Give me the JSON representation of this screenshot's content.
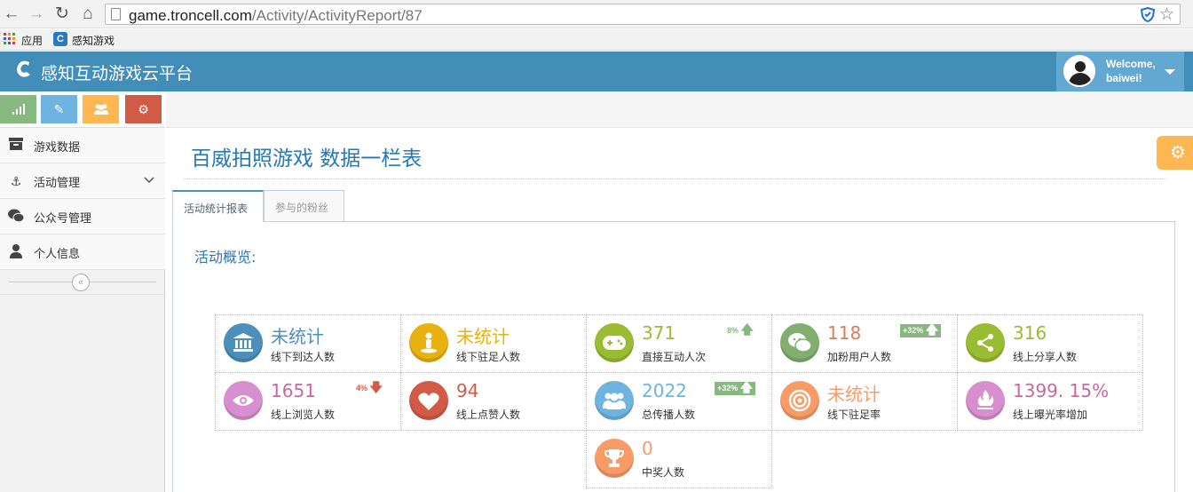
{
  "browser": {
    "url_host": "game.troncell.com",
    "url_path": "/Activity/ActivityReport/87",
    "bookmarks": [
      {
        "label": "应用"
      },
      {
        "label": "感知游戏"
      }
    ]
  },
  "navbar": {
    "brand": "感知互动游戏云平台",
    "welcome_line1": "Welcome,",
    "welcome_line2": "baiwei!"
  },
  "sidebar": {
    "shortcuts": [
      {
        "icon": "signal-icon",
        "color": "#87b87f"
      },
      {
        "icon": "pencil-icon",
        "color": "#6fb3e0"
      },
      {
        "icon": "group-icon",
        "color": "#ffb752"
      },
      {
        "icon": "cogs-icon",
        "color": "#d15b47"
      }
    ],
    "items": [
      {
        "label": "游戏数据",
        "icon": "archive-icon"
      },
      {
        "label": "活动管理",
        "icon": "anchor-icon"
      },
      {
        "label": "公众号管理",
        "icon": "wechat-icon"
      },
      {
        "label": "个人信息",
        "icon": "user-icon"
      }
    ]
  },
  "page": {
    "title": "百威拍照游戏 数据一栏表",
    "tabs": [
      {
        "label": "活动统计报表",
        "active": true
      },
      {
        "label": "参与的粉丝",
        "active": false
      }
    ],
    "overview_title": "活动概览:"
  },
  "stats": [
    {
      "value": "未统计",
      "label": "线下到达人数",
      "icon": "bank-icon",
      "color": "#4c8fbd"
    },
    {
      "value": "未统计",
      "label": "线下驻足人数",
      "icon": "standing-person-icon",
      "color": "#e8b110"
    },
    {
      "value": "371",
      "label": "直接互动人次",
      "icon": "gamepad-icon",
      "color": "#9abc32",
      "trend": "8%",
      "trend_dir": "up"
    },
    {
      "value": "118",
      "label": "加粉用户人数",
      "icon": "wechat-icon",
      "color": "#e07a5f",
      "trend": "+32%",
      "trend_dir": "up"
    },
    {
      "value": "316",
      "label": "线上分享人数",
      "icon": "share-icon",
      "color": "#9abc32"
    },
    {
      "value": "1651",
      "label": "线上浏览人数",
      "icon": "eye-icon",
      "color": "#c6699f",
      "trend": "4%",
      "trend_dir": "down"
    },
    {
      "value": "94",
      "label": "线上点赞人数",
      "icon": "heart-icon",
      "color": "#d15b47"
    },
    {
      "value": "2022",
      "label": "总传播人数",
      "icon": "group-icon",
      "color": "#6fb3e0",
      "trend": "+32%",
      "trend_dir": "up"
    },
    {
      "value": "未统计",
      "label": "线下驻足率",
      "icon": "target-icon",
      "color": "#f89b67"
    },
    {
      "value": "1399. 15%",
      "label": "线上曝光率增加",
      "icon": "fire-icon",
      "color": "#c6699f"
    },
    {
      "value": "0",
      "label": "中奖人数",
      "icon": "trophy-icon",
      "color": "#f89b67"
    }
  ]
}
